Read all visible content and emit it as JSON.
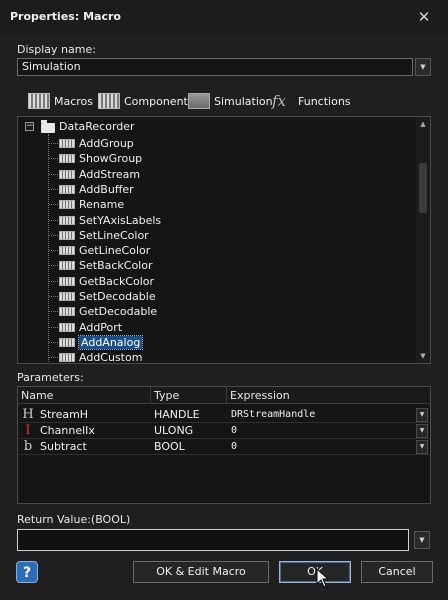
{
  "window": {
    "title": "Properties: Macro"
  },
  "display_name": {
    "label": "Display name:",
    "value": "Simulation"
  },
  "tabs": [
    {
      "label": "Macros",
      "icon": "macros-icon"
    },
    {
      "label": "Components",
      "icon": "components-icon"
    },
    {
      "label": "Simulation",
      "icon": "simulation-icon"
    },
    {
      "label": "Functions",
      "icon": "functions-icon"
    }
  ],
  "tree": {
    "root": "DataRecorder",
    "items": [
      "AddGroup",
      "ShowGroup",
      "AddStream",
      "AddBuffer",
      "Rename",
      "SetYAxisLabels",
      "SetLineColor",
      "GetLineColor",
      "SetBackColor",
      "GetBackColor",
      "SetDecodable",
      "GetDecodable",
      "AddPort",
      "AddAnalog",
      "AddCustom"
    ],
    "selected": "AddAnalog"
  },
  "parameters": {
    "label": "Parameters:",
    "columns": [
      "Name",
      "Type",
      "Expression"
    ],
    "rows": [
      {
        "name": "StreamH",
        "type": "HANDLE",
        "expression": "DRStreamHandle",
        "icon": "handle-icon"
      },
      {
        "name": "ChannelIx",
        "type": "ULONG",
        "expression": "0",
        "icon": "ulong-icon"
      },
      {
        "name": "Subtract",
        "type": "BOOL",
        "expression": "0",
        "icon": "bool-icon"
      }
    ]
  },
  "return_value": {
    "label": "Return Value:(BOOL)",
    "value": ""
  },
  "buttons": {
    "ok_edit": "OK & Edit Macro",
    "ok": "OK",
    "cancel": "Cancel"
  },
  "icons": {
    "help": "?",
    "close": "✕"
  }
}
